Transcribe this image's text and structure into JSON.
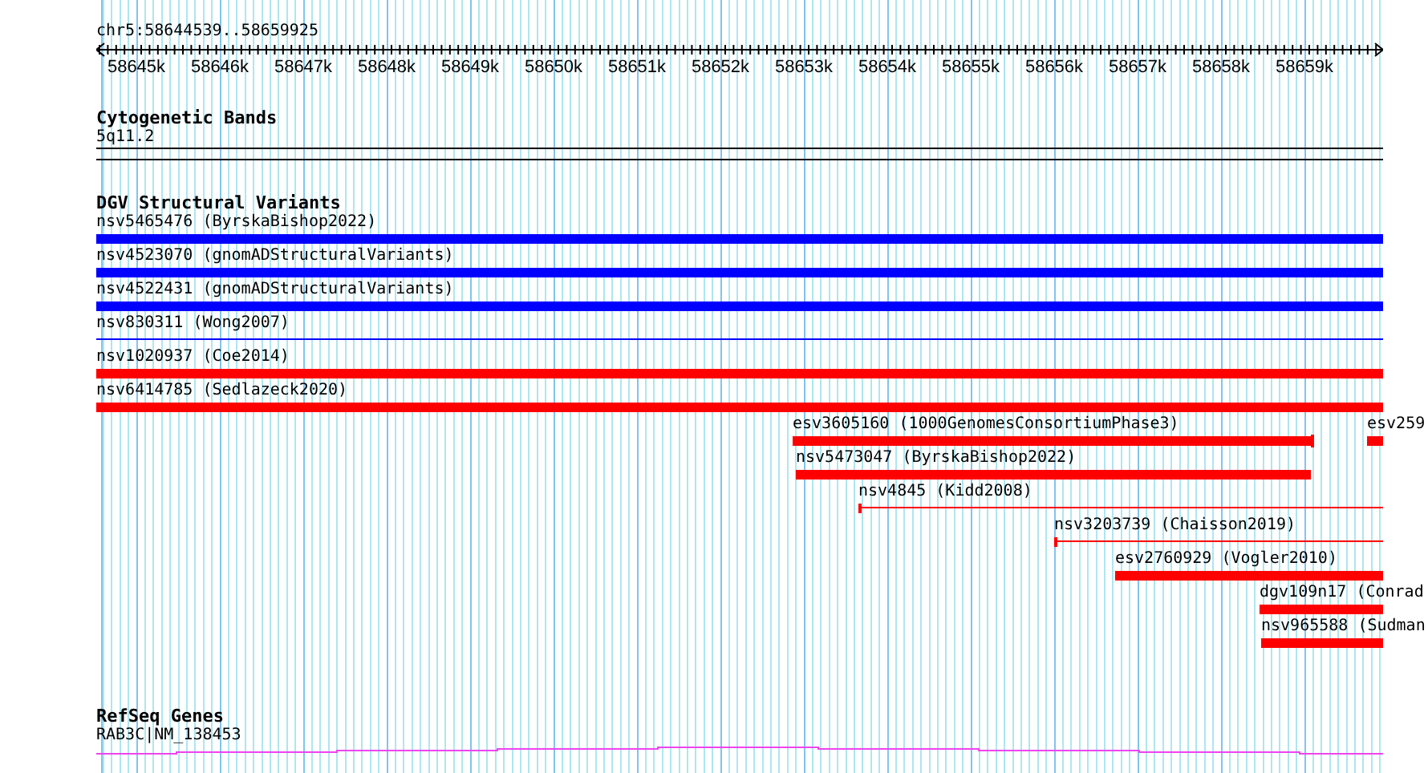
{
  "ruler": {
    "location": "chr5:58644539..58659925",
    "ticks": [
      "58645k",
      "58646k",
      "58647k",
      "58648k",
      "58649k",
      "58650k",
      "58651k",
      "58652k",
      "58653k",
      "58654k",
      "58655k",
      "58656k",
      "58657k",
      "58658k",
      "58659k"
    ]
  },
  "tracks": [
    {
      "kind": "bands",
      "title": "Cytogenetic Bands",
      "features": [
        {
          "label": "5q11.2"
        }
      ]
    },
    {
      "kind": "variants",
      "title": "DGV Structural Variants",
      "rows": [
        [
          {
            "label": "nsv5465476 (ByrskaBishop2022)",
            "color": "#0000ff",
            "kind": "thick",
            "start_tick": false,
            "end_tick": false
          }
        ],
        [
          {
            "label": "nsv4523070 (gnomADStructuralVariants)",
            "color": "#0000ff",
            "kind": "thick",
            "start_tick": false,
            "end_tick": false
          }
        ],
        [
          {
            "label": "nsv4522431 (gnomADStructuralVariants)",
            "color": "#0000ff",
            "kind": "thick",
            "start_tick": false,
            "end_tick": false
          }
        ],
        [
          {
            "label": "nsv830311 (Wong2007)",
            "color": "#0000ff",
            "kind": "thin",
            "start_tick": false,
            "end_tick": false
          }
        ],
        [
          {
            "label": "nsv1020937 (Coe2014)",
            "color": "#ff0000",
            "kind": "thick",
            "start_tick": false,
            "end_tick": false
          }
        ],
        [
          {
            "label": "nsv6414785 (Sedlazeck2020)",
            "color": "#ff0000",
            "kind": "thick",
            "start_tick": false,
            "end_tick": false
          }
        ],
        [
          {
            "label": "esv3605160 (1000GenomesConsortiumPhase3)",
            "color": "#ff0000",
            "kind": "thick",
            "start_tick": false,
            "end_tick": true
          },
          {
            "label": "esv259",
            "color": "#ff0000",
            "kind": "thick",
            "start_tick": false,
            "end_tick": false
          }
        ],
        [
          {
            "label": "nsv5473047 (ByrskaBishop2022)",
            "color": "#ff0000",
            "kind": "thick",
            "start_tick": false,
            "end_tick": false
          }
        ],
        [
          {
            "label": "nsv4845 (Kidd2008)",
            "color": "#ff0000",
            "kind": "thin",
            "start_tick": true,
            "end_tick": false
          }
        ],
        [
          {
            "label": "nsv3203739 (Chaisson2019)",
            "color": "#ff0000",
            "kind": "thin",
            "start_tick": true,
            "end_tick": false
          }
        ],
        [
          {
            "label": "esv2760929 (Vogler2010)",
            "color": "#ff0000",
            "kind": "thick",
            "start_tick": false,
            "end_tick": false
          }
        ],
        [
          {
            "label": "dgv109n17 (Conrad",
            "color": "#ff0000",
            "kind": "thick",
            "start_tick": false,
            "end_tick": false
          }
        ],
        [
          {
            "label": "nsv965588 (Sudman",
            "color": "#ff0000",
            "kind": "thick",
            "start_tick": false,
            "end_tick": false
          }
        ]
      ]
    },
    {
      "kind": "genes",
      "title": "RefSeq Genes",
      "features": [
        {
          "label": "RAB3C|NM_138453",
          "color": "#ee44ee"
        }
      ]
    }
  ]
}
